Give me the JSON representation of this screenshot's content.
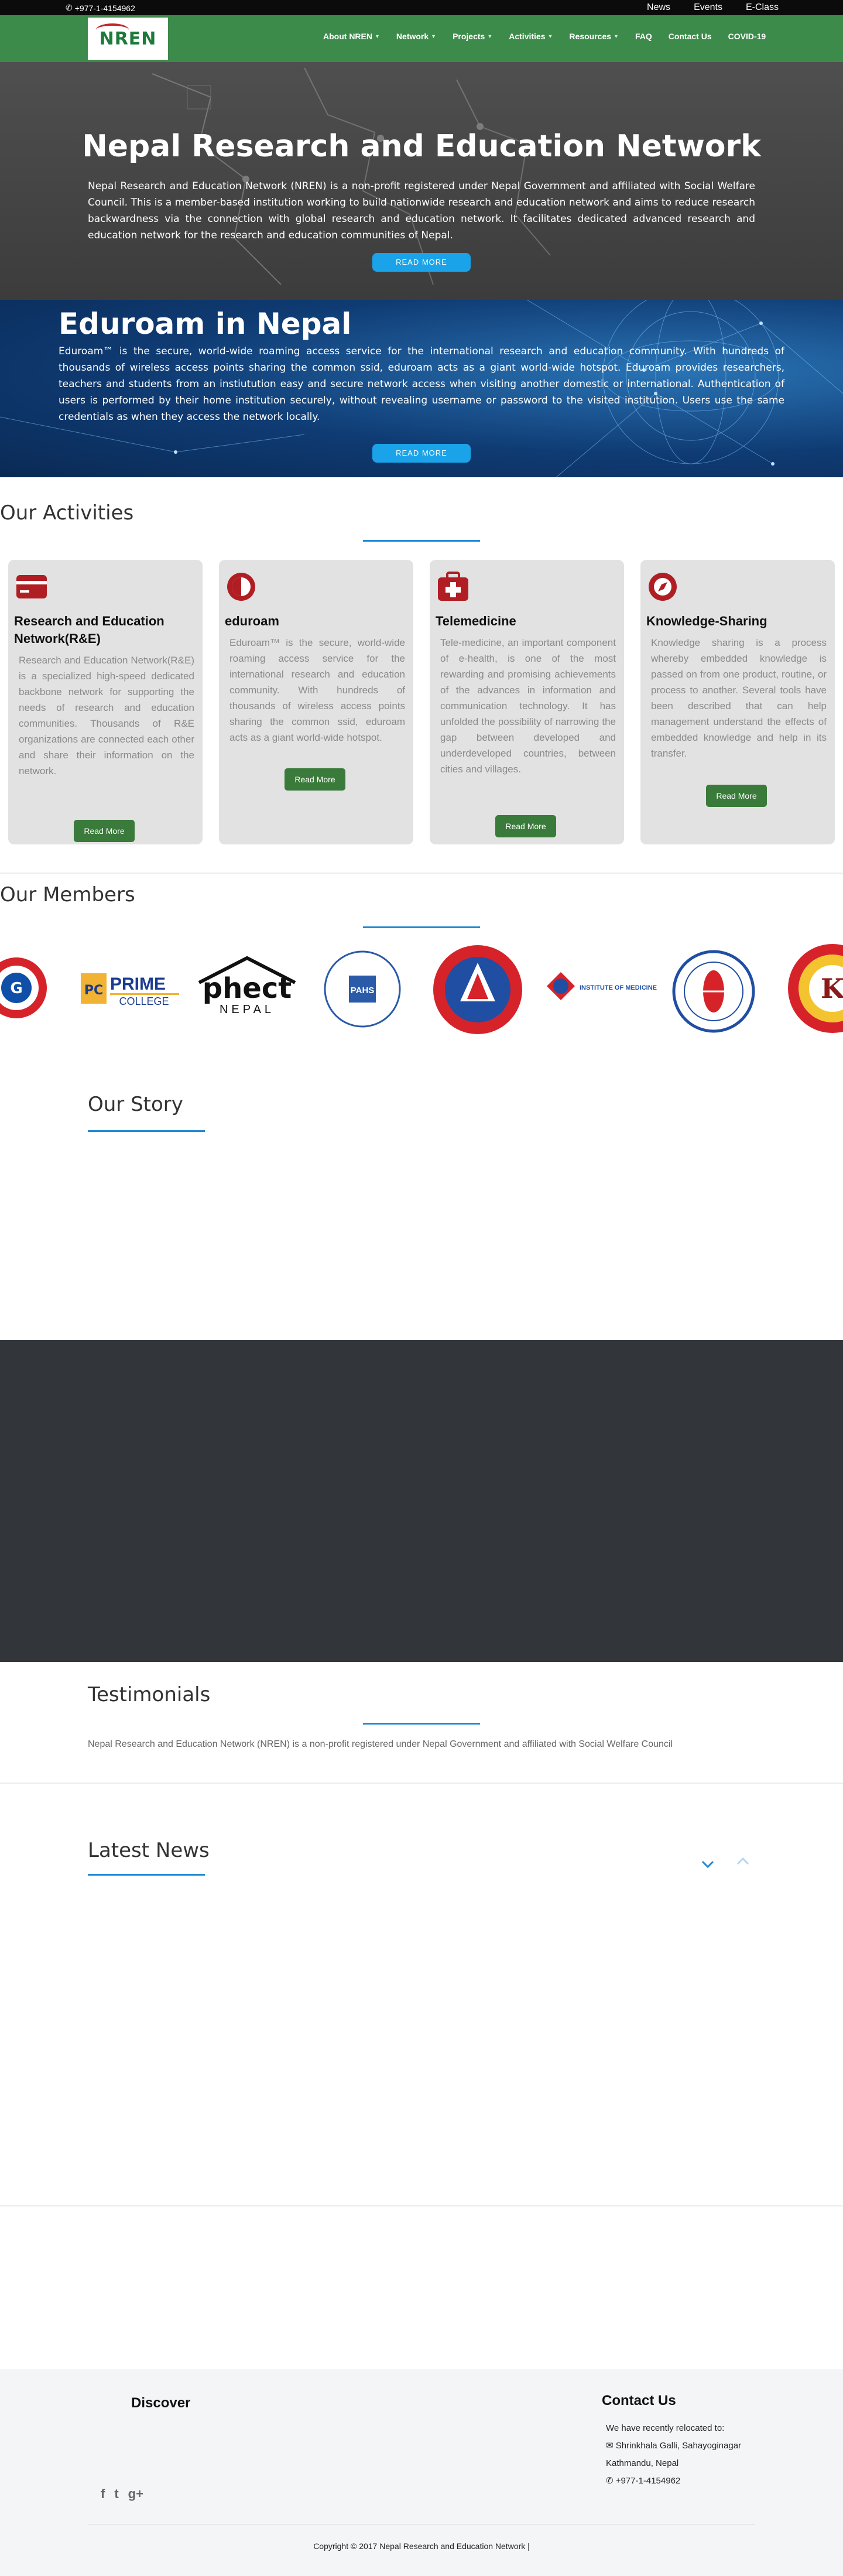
{
  "topbar": {
    "phone": "+977-1-4154962",
    "links": [
      "News",
      "Events",
      "E-Class"
    ]
  },
  "header": {
    "logo_text": "NREN",
    "nav": [
      {
        "label": "About NREN",
        "dropdown": true
      },
      {
        "label": "Network",
        "dropdown": true
      },
      {
        "label": "Projects",
        "dropdown": true
      },
      {
        "label": "Activities",
        "dropdown": true
      },
      {
        "label": "Resources",
        "dropdown": true
      },
      {
        "label": "FAQ",
        "dropdown": false
      },
      {
        "label": "Contact Us",
        "dropdown": false
      },
      {
        "label": "COVID-19",
        "dropdown": false
      }
    ]
  },
  "hero": {
    "title": "Nepal Research and Education Network",
    "text": "Nepal Research and Education Network (NREN) is a non-profit registered under Nepal Government and affiliated with Social Welfare Council. This is a member-based institution working to build nationwide research and education network and aims to reduce research backwardness via the connection with global research and education network. It facilitates dedicated advanced research and education network for the research and education communities of Nepal.",
    "button": "READ MORE"
  },
  "eduroam": {
    "title": "Eduroam in Nepal",
    "text": "Eduroam™ is the secure, world-wide roaming access service for the international research and education community. With hundreds of thousands of wireless access points sharing the common ssid, eduroam acts as a giant world-wide hotspot. Eduroam provides researchers, teachers and students from an instiutution easy and secure network access when visiting another domestic or international. Authentication of users is performed by their home institution securely, without revealing username or password to the visited institution. Users use the same credentials as when they access the network locally.",
    "button": "READ MORE"
  },
  "activities": {
    "title": "Our Activities",
    "cards": [
      {
        "icon": "card-icon",
        "title": "Research and Education Network(R&E)",
        "text": "Research and Education Network(R&E) is a specialized high-speed dedicated backbone network for supporting the needs of research and education communities. Thousands of R&E organizations are connected each other and share their information on the network.",
        "button": "Read More"
      },
      {
        "icon": "half-circle-icon",
        "title": "eduroam",
        "text": "Eduroam™ is the secure, world-wide roaming access service for the international research and education community. With hundreds of thousands of wireless access points sharing the common ssid, eduroam acts as a giant world-wide hotspot.",
        "button": "Read More"
      },
      {
        "icon": "medical-kit-icon",
        "title": "Telemedicine",
        "text": "Tele-medicine, an important component of e-health, is one of the most rewarding and promising achievements of the advances in information and communication technology. It has unfolded the possibility of narrowing the gap between developed and underdeveloped countries, between cities and villages.",
        "button": "Read More"
      },
      {
        "icon": "compass-icon",
        "title": "Knowledge-Sharing",
        "text": "Knowledge sharing is a process whereby embedded knowledge is passed on from one product, routine, or process to another. Several tools have been described that can help management understand the effects of embedded knowledge and help in its transfer.",
        "button": "Read More"
      }
    ]
  },
  "members": {
    "title": "Our Members",
    "logos": [
      {
        "name": "member-logo-1",
        "text": ""
      },
      {
        "name": "prime-college-logo",
        "text": "PRIME",
        "sub": "COLLEGE"
      },
      {
        "name": "phect-nepal-logo",
        "text": "phect",
        "sub": "NEPAL"
      },
      {
        "name": "patan-academy-logo",
        "text": "PAHS",
        "sub": "Patan Academy of Health Sciences"
      },
      {
        "name": "kathmandu-engineering-logo",
        "text": ""
      },
      {
        "name": "institute-of-medicine-logo",
        "text": "INSTITUTE OF MEDICINE"
      },
      {
        "name": "kathmandu-city-college-logo",
        "text": ""
      },
      {
        "name": "member-logo-8",
        "text": "K"
      }
    ]
  },
  "story": {
    "title": "Our Story"
  },
  "testimonials": {
    "title": "Testimonials",
    "text": "Nepal Research and Education Network (NREN) is a non-profit registered under Nepal Government and affiliated with Social Welfare Council"
  },
  "news": {
    "title": "Latest News"
  },
  "footer": {
    "discover_title": "Discover",
    "contact_title": "Contact Us",
    "contact_lines": [
      "We have recently relocated to:",
      "Shrinkhala Galli, Sahayoginagar",
      "Kathmandu, Nepal",
      "+977-1-4154962"
    ],
    "social": [
      "f",
      "t",
      "g+"
    ],
    "copyright": "Copyright © 2017 Nepal Research and Education Network |"
  },
  "colors": {
    "brand_green": "#3d8b4a",
    "accent_blue": "#1f8ad6",
    "button_blue": "#1aa3e8",
    "card_red": "#b01e24",
    "dark_band": "#32353a"
  }
}
